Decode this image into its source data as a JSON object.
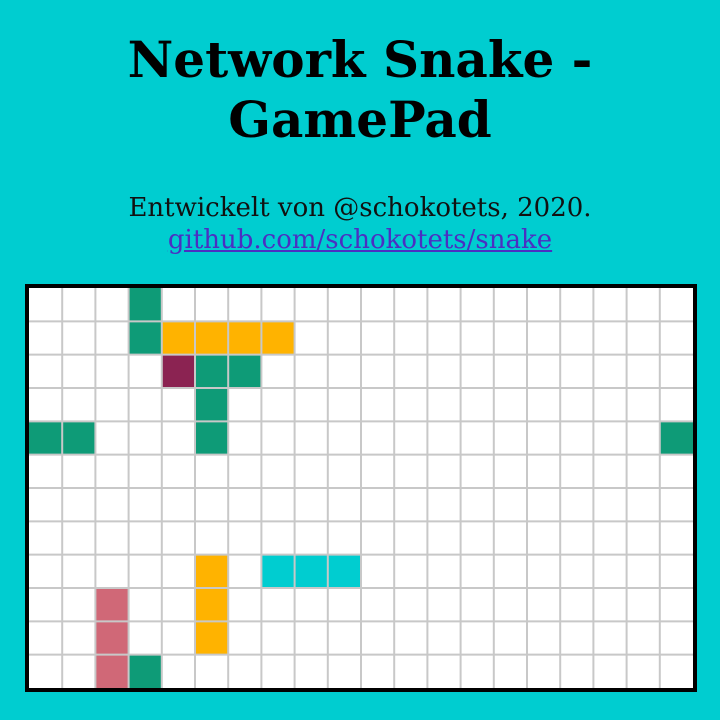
{
  "header": {
    "title_line1": "Network Snake -",
    "title_line2": "GamePad"
  },
  "credits": {
    "text": "Entwickelt von @schokotets, 2020.",
    "link_text": "github.com/schokotets/snake"
  },
  "colors": {
    "background": "#00cdd0",
    "board_background": "#ffffff",
    "grid_line": "#c8c8c8",
    "board_border": "#000000",
    "link": "#4b2fc2"
  },
  "board": {
    "columns": 20,
    "rows": 12,
    "snakes": [
      {
        "id": "green-a",
        "color": "#0e9b77",
        "cells": [
          [
            3,
            0
          ],
          [
            3,
            1
          ]
        ]
      },
      {
        "id": "orange-a",
        "color": "#ffb300",
        "cells": [
          [
            4,
            1
          ],
          [
            5,
            1
          ],
          [
            6,
            1
          ],
          [
            7,
            1
          ]
        ]
      },
      {
        "id": "purple",
        "color": "#8b2352",
        "cells": [
          [
            4,
            2
          ]
        ]
      },
      {
        "id": "green-b",
        "color": "#0e9b77",
        "cells": [
          [
            5,
            2
          ],
          [
            6,
            2
          ],
          [
            5,
            3
          ],
          [
            5,
            4
          ]
        ]
      },
      {
        "id": "green-c",
        "color": "#0e9b77",
        "cells": [
          [
            0,
            4
          ],
          [
            1,
            4
          ],
          [
            19,
            4
          ]
        ]
      },
      {
        "id": "orange-b",
        "color": "#ffb300",
        "cells": [
          [
            5,
            8
          ],
          [
            5,
            9
          ],
          [
            5,
            10
          ]
        ]
      },
      {
        "id": "cyan",
        "color": "#00cdd0",
        "cells": [
          [
            7,
            8
          ],
          [
            8,
            8
          ],
          [
            9,
            8
          ]
        ]
      },
      {
        "id": "pink",
        "color": "#d06877",
        "cells": [
          [
            2,
            9
          ],
          [
            2,
            10
          ],
          [
            2,
            11
          ]
        ]
      },
      {
        "id": "green-d",
        "color": "#0e9b77",
        "cells": [
          [
            3,
            11
          ]
        ]
      }
    ]
  }
}
